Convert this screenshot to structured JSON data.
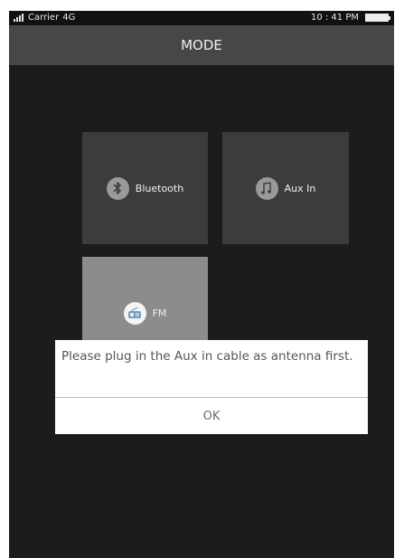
{
  "status_bar": {
    "carrier": "Carrier",
    "network": "4G",
    "time": "10 : 41 PM"
  },
  "header": {
    "title": "MODE"
  },
  "modes": [
    {
      "label": "Bluetooth",
      "icon": "bluetooth-icon"
    },
    {
      "label": "Aux In",
      "icon": "music-note-icon"
    },
    {
      "label": "FM",
      "icon": "radio-icon"
    }
  ],
  "dialog": {
    "message": "Please plug in the Aux in cable as antenna first.",
    "ok_label": "OK"
  },
  "colors": {
    "background": "#1c1c1c",
    "header": "#474747",
    "tile": "#3c3c3c",
    "tile_selected": "#8c8c8c",
    "dialog": "#ffffff"
  }
}
